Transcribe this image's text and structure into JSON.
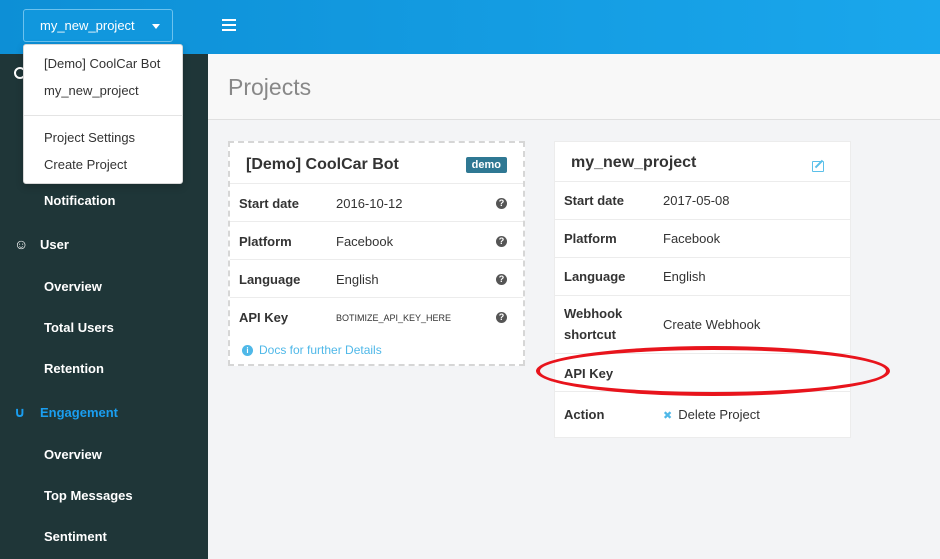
{
  "topbar": {
    "project_selector": "my_new_project",
    "menu_icon": "hamburger-icon",
    "bg_color": "#1199e0"
  },
  "dropdown": {
    "projects": [
      "[Demo] CoolCar Bot",
      "my_new_project"
    ],
    "actions": [
      "Project Settings",
      "Create Project"
    ]
  },
  "sidebar": {
    "items": [
      {
        "label": "Notification",
        "type": "sub"
      },
      {
        "label": "User",
        "type": "section",
        "icon": "user-icon"
      },
      {
        "label": "Overview",
        "type": "sub"
      },
      {
        "label": "Total Users",
        "type": "sub"
      },
      {
        "label": "Retention",
        "type": "sub"
      },
      {
        "label": "Engagement",
        "type": "section",
        "icon": "magnet-icon",
        "active": true
      },
      {
        "label": "Overview",
        "type": "sub"
      },
      {
        "label": "Top Messages",
        "type": "sub"
      },
      {
        "label": "Sentiment",
        "type": "sub"
      }
    ]
  },
  "page": {
    "title": "Projects"
  },
  "demo_card": {
    "title": "[Demo] CoolCar Bot",
    "badge": "demo",
    "rows": [
      {
        "label": "Start date",
        "value": "2016-10-12"
      },
      {
        "label": "Platform",
        "value": "Facebook"
      },
      {
        "label": "Language",
        "value": "English"
      },
      {
        "label": "API Key",
        "value": "BOTIMIZE_API_KEY_HERE"
      }
    ],
    "docs_link": "Docs for further Details"
  },
  "project_card": {
    "title": "my_new_project",
    "rows": [
      {
        "label": "Start date",
        "value": "2017-05-08"
      },
      {
        "label": "Platform",
        "value": "Facebook"
      },
      {
        "label": "Language",
        "value": "English"
      },
      {
        "label": "Webhook shortcut",
        "label_line1": "Webhook",
        "label_line2": "shortcut",
        "value": "Create Webhook"
      },
      {
        "label": "API Key",
        "value": ""
      },
      {
        "label": "Action",
        "value": "Delete Project"
      }
    ]
  },
  "colors": {
    "accent": "#4fb8e8",
    "sidebar": "#1f3638",
    "highlight": "#e8141c",
    "badge": "#2f7893"
  }
}
